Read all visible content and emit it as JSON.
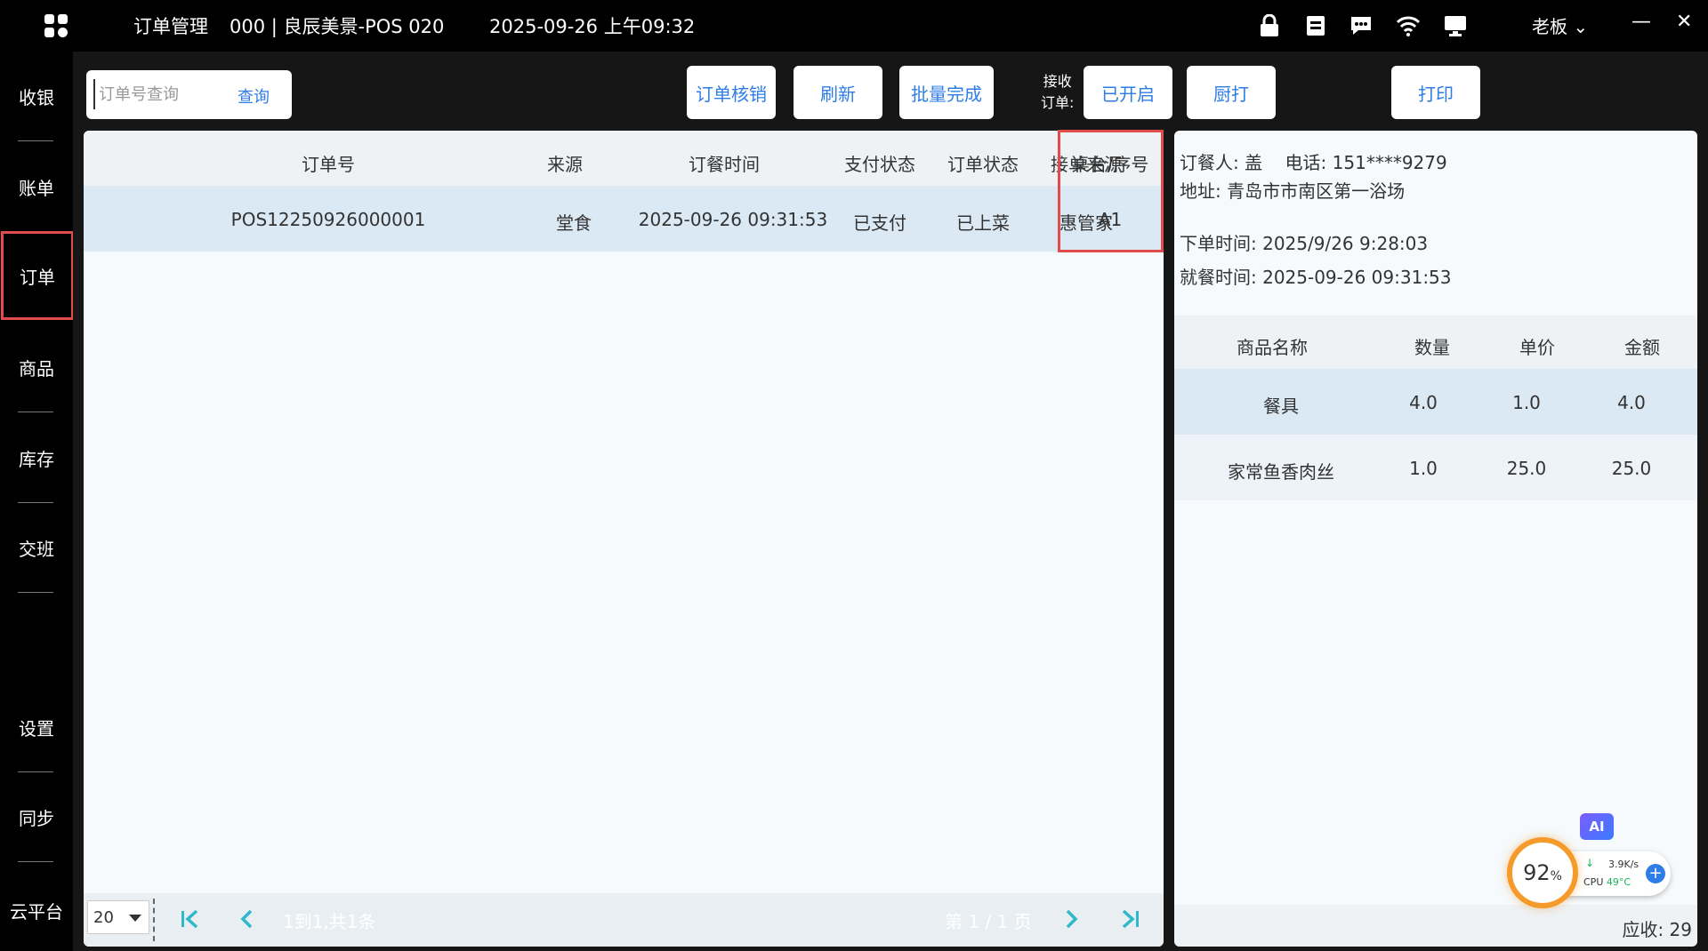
{
  "titlebar": {
    "title": "订单管理",
    "store": "000 | 良辰美景-POS 020",
    "datetime": "2025-09-26 上午09:32",
    "user": "老板 ⌄",
    "minimize": "—",
    "close": "✕"
  },
  "sidebar": {
    "items": [
      {
        "label": "收银"
      },
      {
        "label": "账单"
      },
      {
        "label": "订单"
      },
      {
        "label": "商品"
      },
      {
        "label": "库存"
      },
      {
        "label": "交班"
      },
      {
        "label": "设置"
      },
      {
        "label": "同步"
      },
      {
        "label": "云平台"
      }
    ]
  },
  "toolbar": {
    "search_placeholder": "订单号查询",
    "search_label": "查询",
    "verify_label": "订单核销",
    "refresh_label": "刷新",
    "batch_label": "批量完成",
    "receive_label_1": "接收",
    "receive_label_2": "订单:",
    "enabled_label": "已开启",
    "kitchen_label": "厨打",
    "print_label": "打印"
  },
  "orders": {
    "headers": [
      "订单号",
      "来源",
      "订餐时间",
      "支付状态",
      "订单状态",
      "接单来源",
      "桌台/序号"
    ],
    "rows": [
      [
        "POS12250926000001",
        "堂食",
        "2025-09-26 09:31:53",
        "已支付",
        "已上菜",
        "惠管家",
        "A1"
      ]
    ]
  },
  "pager": {
    "page_size": "20",
    "summary": "1到1,共1条",
    "page_info": "第 1 / 1 页"
  },
  "detail": {
    "customer": "订餐人: 盖",
    "phone": "电话: 151****9279",
    "address": "地址: 青岛市市南区第一浴场",
    "order_time": "下单时间: 2025/9/26 9:28:03",
    "dine_time": "就餐时间: 2025-09-26 09:31:53",
    "headers": [
      "商品名称",
      "数量",
      "单价",
      "金额"
    ],
    "rows": [
      [
        "餐具",
        "4.0",
        "1.0",
        "4.0"
      ],
      [
        "家常鱼香肉丝",
        "1.0",
        "25.0",
        "25.0"
      ]
    ],
    "total": "应收: 29"
  },
  "monitor": {
    "ai": "AI",
    "percent": "92",
    "percent_unit": "%",
    "speed": "3.9K/s",
    "cpu_label": "CPU",
    "cpu_temp": "49°C",
    "down_arrow": "↓",
    "plus": "+"
  },
  "colors": {
    "accent": "#2e7de6",
    "highlight": "#e04b4b",
    "ring": "#f59b2b"
  }
}
